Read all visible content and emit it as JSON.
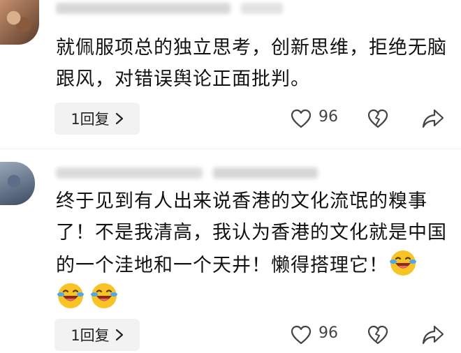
{
  "comments": [
    {
      "text": "就佩服项总的独立思考，创新思维，拒绝无脑跟风，对错误舆论正面批判。",
      "emojis": [],
      "reply_label": "1回复",
      "like_count": "96"
    },
    {
      "text": "终于见到有人出来说香港的文化流氓的糗事了！不是我清高，我认为香港的文化就是中国的一个洼地和一个天井！懒得搭理它！",
      "emojis": [
        "laughing-crying-emoji",
        "laughing-crying-emoji",
        "laughing-crying-emoji"
      ],
      "reply_label": "1回复",
      "like_count": "96"
    }
  ],
  "icons": {
    "like": "heart-outline-icon",
    "dislike": "broken-heart-icon",
    "share": "share-arrow-icon",
    "reply_chevron": "chevron-right-icon"
  },
  "colors": {
    "text": "#111111",
    "reply_pill_bg": "#f2f2f2",
    "icon": "#444444",
    "emoji_face": "#f7c325"
  }
}
